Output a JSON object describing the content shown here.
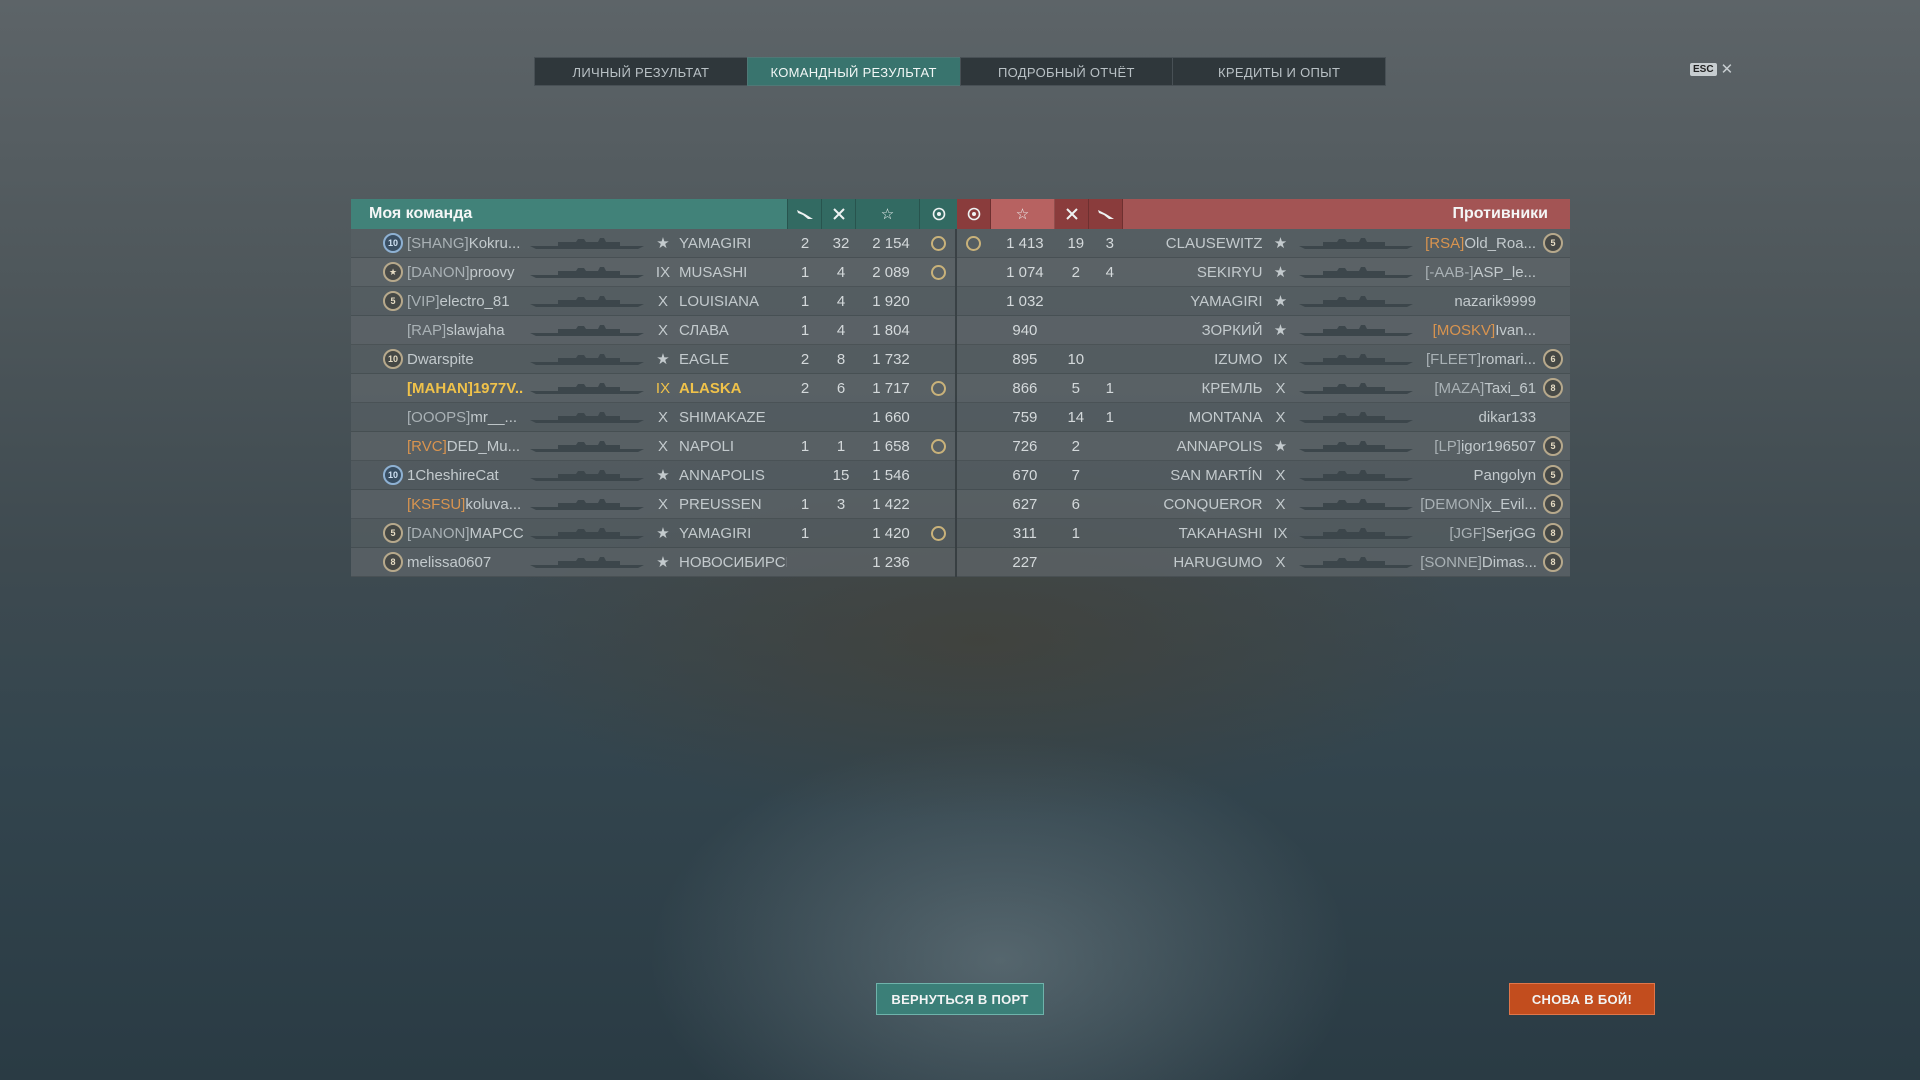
{
  "tabs": [
    {
      "label": "ЛИЧНЫЙ РЕЗУЛЬТАТ",
      "active": false
    },
    {
      "label": "КОМАНДНЫЙ РЕЗУЛЬТАТ",
      "active": true
    },
    {
      "label": "ПОДРОБНЫЙ ОТЧЁТ",
      "active": false
    },
    {
      "label": "КРЕДИТЫ И ОПЫТ",
      "active": false
    }
  ],
  "esc": {
    "key": "ESC",
    "close": "✕"
  },
  "my_team": {
    "title": "Моя команда",
    "rows": [
      {
        "rank": "10",
        "rank_style": "blue",
        "clan": "[SHANG]",
        "clan_orange": false,
        "name": "Kokru...",
        "tier": "★",
        "ship": "YAMAGIRI",
        "s1": "2",
        "s2": "32",
        "xp": "2 154",
        "ach": true
      },
      {
        "rank": "★",
        "rank_style": "gold",
        "clan": "[DANON]",
        "clan_orange": false,
        "name": "proovy",
        "tier": "IX",
        "ship": "MUSASHI",
        "s1": "1",
        "s2": "4",
        "xp": "2 089",
        "ach": true
      },
      {
        "rank": "5",
        "rank_style": "gold",
        "clan": "[VIP]",
        "clan_orange": false,
        "name": "electro_81",
        "tier": "X",
        "ship": "LOUISIANA",
        "s1": "1",
        "s2": "4",
        "xp": "1 920",
        "ach": false
      },
      {
        "rank": "",
        "rank_style": "",
        "clan": "[RAP]",
        "clan_orange": false,
        "name": "slawjaha",
        "tier": "X",
        "ship": "СЛАВА",
        "s1": "1",
        "s2": "4",
        "xp": "1 804",
        "ach": false
      },
      {
        "rank": "10",
        "rank_style": "gold",
        "clan": "",
        "clan_orange": false,
        "name": "Dwarspite",
        "tier": "★",
        "ship": "EAGLE",
        "s1": "2",
        "s2": "8",
        "xp": "1 732",
        "ach": false
      },
      {
        "rank": "",
        "rank_style": "",
        "clan": "[MAHAN]",
        "clan_orange": false,
        "name": "1977V...",
        "tier": "IX",
        "ship": "ALASKA",
        "s1": "2",
        "s2": "6",
        "xp": "1 717",
        "ach": true,
        "me": true
      },
      {
        "rank": "",
        "rank_style": "",
        "clan": "[OOOPS]",
        "clan_orange": false,
        "name": "mr__...",
        "tier": "X",
        "ship": "SHIMAKAZE",
        "s1": "",
        "s2": "",
        "xp": "1 660",
        "ach": false
      },
      {
        "rank": "",
        "rank_style": "",
        "clan": "[RVC]",
        "clan_orange": true,
        "name": "DED_Mu...",
        "tier": "X",
        "ship": "NAPOLI",
        "s1": "1",
        "s2": "1",
        "xp": "1 658",
        "ach": true
      },
      {
        "rank": "10",
        "rank_style": "blue",
        "clan": "",
        "clan_orange": false,
        "name": "1CheshireCat",
        "tier": "★",
        "ship": "ANNAPOLIS",
        "s1": "",
        "s2": "15",
        "xp": "1 546",
        "ach": false
      },
      {
        "rank": "",
        "rank_style": "",
        "clan": "[KSFSU]",
        "clan_orange": true,
        "name": "koluva...",
        "tier": "X",
        "ship": "PREUSSEN",
        "s1": "1",
        "s2": "3",
        "xp": "1 422",
        "ach": false
      },
      {
        "rank": "5",
        "rank_style": "gold",
        "clan": "[DANON]",
        "clan_orange": false,
        "name": "MAPCC",
        "tier": "★",
        "ship": "YAMAGIRI",
        "s1": "1",
        "s2": "",
        "xp": "1 420",
        "ach": true
      },
      {
        "rank": "8",
        "rank_style": "gold",
        "clan": "",
        "clan_orange": false,
        "name": "melissa0607",
        "tier": "★",
        "ship": "НОВОСИБИРСК",
        "s1": "",
        "s2": "",
        "xp": "1 236",
        "ach": false
      }
    ]
  },
  "enemy_team": {
    "title": "Противники",
    "rows": [
      {
        "ach": true,
        "xp": "1 413",
        "s2": "19",
        "s1": "3",
        "ship": "CLAUSEWITZ",
        "tier": "★",
        "clan": "[RSA]",
        "clan_orange": true,
        "name": "Old_Roa...",
        "rank": "5"
      },
      {
        "ach": false,
        "xp": "1 074",
        "s2": "2",
        "s1": "4",
        "ship": "SEKIRYU",
        "tier": "★",
        "clan": "[-AAB-]",
        "clan_orange": false,
        "name": "ASP_le...",
        "rank": ""
      },
      {
        "ach": false,
        "xp": "1 032",
        "s2": "",
        "s1": "",
        "ship": "YAMAGIRI",
        "tier": "★",
        "clan": "",
        "clan_orange": false,
        "name": "nazarik9999",
        "rank": ""
      },
      {
        "ach": false,
        "xp": "940",
        "s2": "",
        "s1": "",
        "ship": "ЗОРКИЙ",
        "tier": "★",
        "clan": "[MOSKV]",
        "clan_orange": true,
        "name": "Ivan...",
        "rank": ""
      },
      {
        "ach": false,
        "xp": "895",
        "s2": "10",
        "s1": "",
        "ship": "IZUMO",
        "tier": "IX",
        "clan": "[FLEET]",
        "clan_orange": false,
        "name": "romari...",
        "rank": "6"
      },
      {
        "ach": false,
        "xp": "866",
        "s2": "5",
        "s1": "1",
        "ship": "КРЕМЛЬ",
        "tier": "X",
        "clan": "[MAZA]",
        "clan_orange": false,
        "name": "Taxi_61",
        "rank": "8"
      },
      {
        "ach": false,
        "xp": "759",
        "s2": "14",
        "s1": "1",
        "ship": "MONTANA",
        "tier": "X",
        "clan": "",
        "clan_orange": false,
        "name": "dikar133",
        "rank": ""
      },
      {
        "ach": false,
        "xp": "726",
        "s2": "2",
        "s1": "",
        "ship": "ANNAPOLIS",
        "tier": "★",
        "clan": "[LP]",
        "clan_orange": false,
        "name": "igor196507",
        "rank": "5"
      },
      {
        "ach": false,
        "xp": "670",
        "s2": "7",
        "s1": "",
        "ship": "SAN MARTÍN",
        "tier": "X",
        "clan": "",
        "clan_orange": false,
        "name": "Pangolyn",
        "rank": "5"
      },
      {
        "ach": false,
        "xp": "627",
        "s2": "6",
        "s1": "",
        "ship": "CONQUEROR",
        "tier": "X",
        "clan": "[DEMON]",
        "clan_orange": false,
        "name": "x_Evil...",
        "rank": "6"
      },
      {
        "ach": false,
        "xp": "311",
        "s2": "1",
        "s1": "",
        "ship": "TAKAHASHI",
        "tier": "IX",
        "clan": "[JGF]",
        "clan_orange": false,
        "name": "SerjGG",
        "rank": "8"
      },
      {
        "ach": false,
        "xp": "227",
        "s2": "",
        "s1": "",
        "ship": "HARUGUMO",
        "tier": "X",
        "clan": "[SONNE]",
        "clan_orange": false,
        "name": "Dimas...",
        "rank": "8"
      }
    ]
  },
  "buttons": {
    "port": "ВЕРНУТЬСЯ В ПОРТ",
    "battle": "СНОВА В БОЙ!"
  },
  "colors": {
    "team_accent": "#3f877d",
    "enemy_accent": "#b25452",
    "player_highlight": "#f0c24a",
    "battle_button": "#c24d1e"
  }
}
